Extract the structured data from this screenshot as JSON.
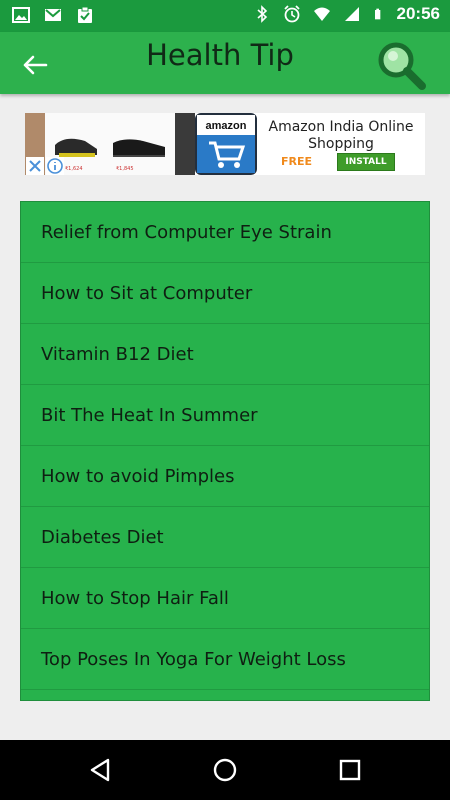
{
  "status_bar": {
    "left_icons": [
      "image-icon",
      "gmail-icon",
      "clipboard-check-icon"
    ],
    "right_icons": [
      "bluetooth-icon",
      "alarm-icon",
      "wifi-icon",
      "signal-icon",
      "battery-icon"
    ],
    "time": "20:56"
  },
  "app_bar": {
    "title": "Health Tip",
    "back_icon": "arrow-left-icon",
    "search_icon": "search-icon",
    "color": "#2db14d"
  },
  "ad": {
    "brand": "amazon",
    "title": "Amazon India Online Shopping",
    "free_label": "FREE",
    "install_label": "INSTALL",
    "prices": [
      "₹1,624",
      "₹1,845"
    ]
  },
  "tips": [
    "Relief from Computer Eye Strain",
    "How to Sit at Computer",
    "Vitamin B12 Diet",
    "Bit The Heat In Summer",
    "How to avoid Pimples",
    "Diabetes Diet",
    "How to Stop Hair Fall",
    "Top Poses In Yoga For Weight Loss"
  ],
  "nav_bar": {
    "back": "back-triangle-icon",
    "home": "home-circle-icon",
    "recents": "recents-square-icon"
  },
  "colors": {
    "status_bar": "#1b9a3e",
    "list_bg": "#27b24c",
    "page_bg": "#eeeeee"
  }
}
